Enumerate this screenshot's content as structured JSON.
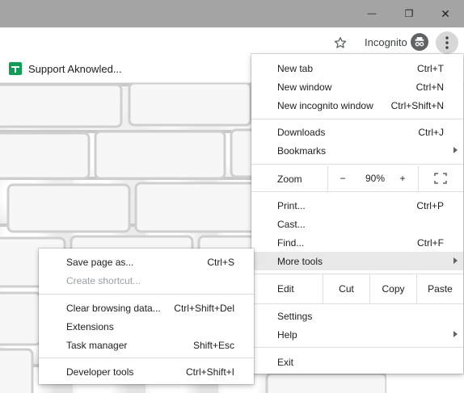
{
  "window": {
    "minimize_glyph": "—",
    "restore_glyph": "❐",
    "close_glyph": "✕"
  },
  "toolbar": {
    "incognito_label": "Incognito"
  },
  "bookmarks": {
    "items": [
      {
        "label": "Support Aknowled...",
        "icon": "google-sheets-icon"
      }
    ]
  },
  "menu": {
    "new_tab": {
      "label": "New tab",
      "shortcut": "Ctrl+T"
    },
    "new_window": {
      "label": "New window",
      "shortcut": "Ctrl+N"
    },
    "new_incognito": {
      "label": "New incognito window",
      "shortcut": "Ctrl+Shift+N"
    },
    "downloads": {
      "label": "Downloads",
      "shortcut": "Ctrl+J"
    },
    "bookmarks": {
      "label": "Bookmarks"
    },
    "zoom": {
      "label": "Zoom",
      "minus": "−",
      "value": "90%",
      "plus": "+"
    },
    "print": {
      "label": "Print...",
      "shortcut": "Ctrl+P"
    },
    "cast": {
      "label": "Cast..."
    },
    "find": {
      "label": "Find...",
      "shortcut": "Ctrl+F"
    },
    "more_tools": {
      "label": "More tools"
    },
    "edit": {
      "label": "Edit",
      "cut": "Cut",
      "copy": "Copy",
      "paste": "Paste"
    },
    "settings": {
      "label": "Settings"
    },
    "help": {
      "label": "Help"
    },
    "exit": {
      "label": "Exit"
    }
  },
  "submenu": {
    "save_page": {
      "label": "Save page as...",
      "shortcut": "Ctrl+S"
    },
    "create_shortcut": {
      "label": "Create shortcut..."
    },
    "clear_browsing": {
      "label": "Clear browsing data...",
      "shortcut": "Ctrl+Shift+Del"
    },
    "extensions": {
      "label": "Extensions"
    },
    "task_manager": {
      "label": "Task manager",
      "shortcut": "Shift+Esc"
    },
    "developer_tools": {
      "label": "Developer tools",
      "shortcut": "Ctrl+Shift+I"
    }
  }
}
